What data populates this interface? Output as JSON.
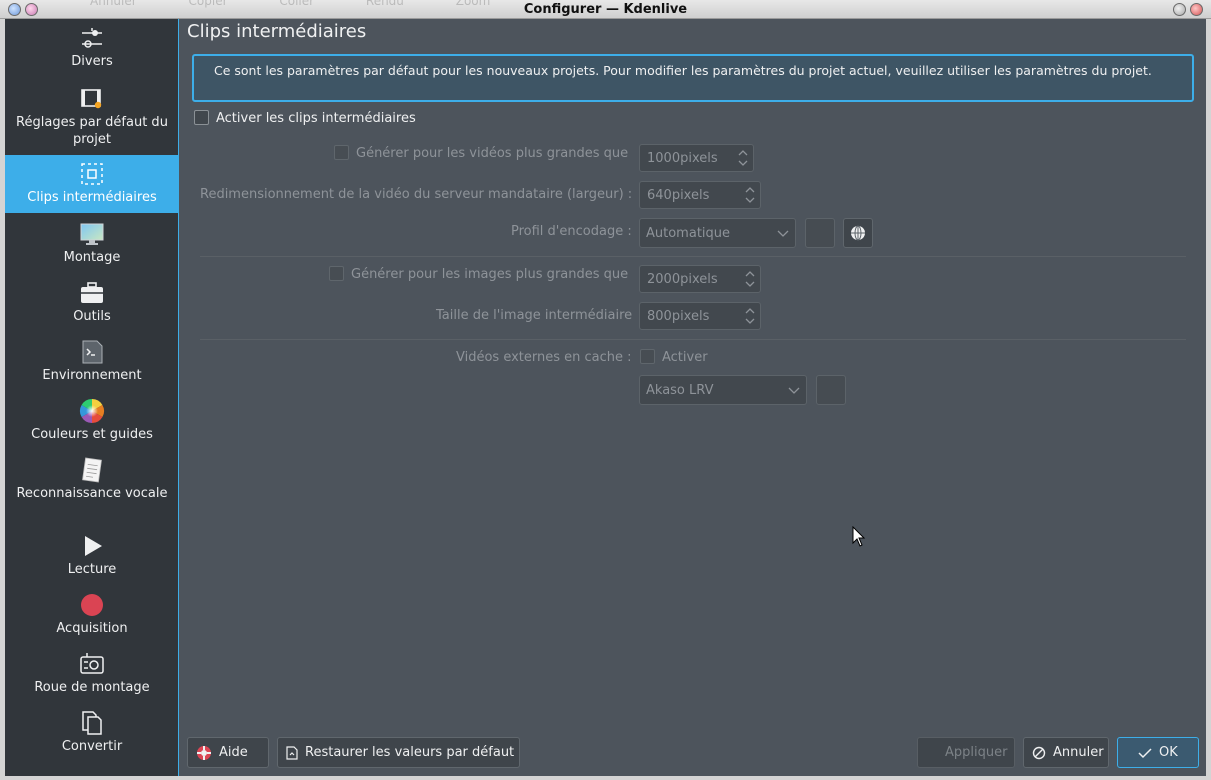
{
  "window": {
    "title": "Configurer — Kdenlive",
    "background_toolbar": [
      "Annuler",
      "Copier",
      "Coller",
      "Rendu",
      "Zoom"
    ]
  },
  "sidebar": {
    "items": [
      {
        "label": "Divers",
        "icon": "sliders-icon"
      },
      {
        "label": "Réglages par défaut du projet",
        "icon": "film-settings-icon"
      },
      {
        "label": "Clips intermédiaires",
        "icon": "proxy-clips-icon",
        "active": true
      },
      {
        "label": "Montage",
        "icon": "monitor-icon"
      },
      {
        "label": "Outils",
        "icon": "toolbox-icon"
      },
      {
        "label": "Environnement",
        "icon": "terminal-icon"
      },
      {
        "label": "Couleurs et guides",
        "icon": "color-wheel-icon"
      },
      {
        "label": "Reconnaissance vocale",
        "icon": "notepad-icon"
      },
      {
        "label": "Lecture",
        "icon": "play-icon"
      },
      {
        "label": "Acquisition",
        "icon": "record-icon"
      },
      {
        "label": "Roue de montage",
        "icon": "jog-wheel-icon"
      },
      {
        "label": "Convertir",
        "icon": "copy-icon"
      }
    ]
  },
  "page": {
    "title": "Clips intermédiaires",
    "info": "Ce sont les paramètres par défaut pour les nouveaux projets. Pour modifier les paramètres du projet actuel, veuillez utiliser les paramètres du projet.",
    "enable_proxy_label": "Activer les clips intermédiaires",
    "video_threshold_label": "Générer pour les vidéos plus grandes que",
    "video_threshold_value": "1000pixels",
    "proxy_resize_label": "Redimensionnement de la vidéo du serveur mandataire (largeur) :",
    "proxy_resize_value": "640pixels",
    "encoding_profile_label": "Profil d'encodage :",
    "encoding_profile_value": "Automatique",
    "image_threshold_label": "Générer pour les images plus grandes que",
    "image_threshold_value": "2000pixels",
    "image_size_label": "Taille de l'image intermédiaire",
    "image_size_value": "800pixels",
    "external_cache_label": "Vidéos externes en cache :",
    "external_cache_checkbox": "Activer",
    "external_profile_value": "Akaso LRV"
  },
  "buttons": {
    "help": "Aide",
    "restore": "Restaurer les valeurs par défaut",
    "apply": "Appliquer",
    "cancel": "Annuler",
    "ok": "OK"
  },
  "colors": {
    "accent": "#3daee9",
    "sidebar_bg": "#31363b",
    "content_bg": "#4d545c"
  }
}
